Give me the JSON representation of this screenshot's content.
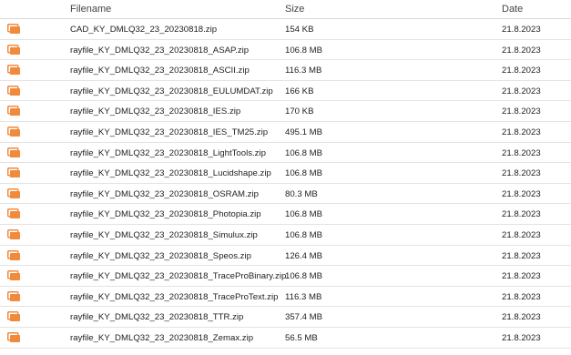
{
  "header": {
    "filename": "Filename",
    "size": "Size",
    "date": "Date"
  },
  "icon": {
    "name": "archive-file-icon",
    "color": "#f08a3c"
  },
  "files": [
    {
      "name": "CAD_KY_DMLQ32_23_20230818.zip",
      "size": "154 KB",
      "date": "21.8.2023"
    },
    {
      "name": "rayfile_KY_DMLQ32_23_20230818_ASAP.zip",
      "size": "106.8 MB",
      "date": "21.8.2023"
    },
    {
      "name": "rayfile_KY_DMLQ32_23_20230818_ASCII.zip",
      "size": "116.3 MB",
      "date": "21.8.2023"
    },
    {
      "name": "rayfile_KY_DMLQ32_23_20230818_EULUMDAT.zip",
      "size": "166 KB",
      "date": "21.8.2023"
    },
    {
      "name": "rayfile_KY_DMLQ32_23_20230818_IES.zip",
      "size": "170 KB",
      "date": "21.8.2023"
    },
    {
      "name": "rayfile_KY_DMLQ32_23_20230818_IES_TM25.zip",
      "size": "495.1 MB",
      "date": "21.8.2023"
    },
    {
      "name": "rayfile_KY_DMLQ32_23_20230818_LightTools.zip",
      "size": "106.8 MB",
      "date": "21.8.2023"
    },
    {
      "name": "rayfile_KY_DMLQ32_23_20230818_Lucidshape.zip",
      "size": "106.8 MB",
      "date": "21.8.2023"
    },
    {
      "name": "rayfile_KY_DMLQ32_23_20230818_OSRAM.zip",
      "size": "80.3 MB",
      "date": "21.8.2023"
    },
    {
      "name": "rayfile_KY_DMLQ32_23_20230818_Photopia.zip",
      "size": "106.8 MB",
      "date": "21.8.2023"
    },
    {
      "name": "rayfile_KY_DMLQ32_23_20230818_Simulux.zip",
      "size": "106.8 MB",
      "date": "21.8.2023"
    },
    {
      "name": "rayfile_KY_DMLQ32_23_20230818_Speos.zip",
      "size": "126.4 MB",
      "date": "21.8.2023"
    },
    {
      "name": "rayfile_KY_DMLQ32_23_20230818_TraceProBinary.zip",
      "size": "106.8 MB",
      "date": "21.8.2023"
    },
    {
      "name": "rayfile_KY_DMLQ32_23_20230818_TraceProText.zip",
      "size": "116.3 MB",
      "date": "21.8.2023"
    },
    {
      "name": "rayfile_KY_DMLQ32_23_20230818_TTR.zip",
      "size": "357.4 MB",
      "date": "21.8.2023"
    },
    {
      "name": "rayfile_KY_DMLQ32_23_20230818_Zemax.zip",
      "size": "56.5 MB",
      "date": "21.8.2023"
    }
  ]
}
